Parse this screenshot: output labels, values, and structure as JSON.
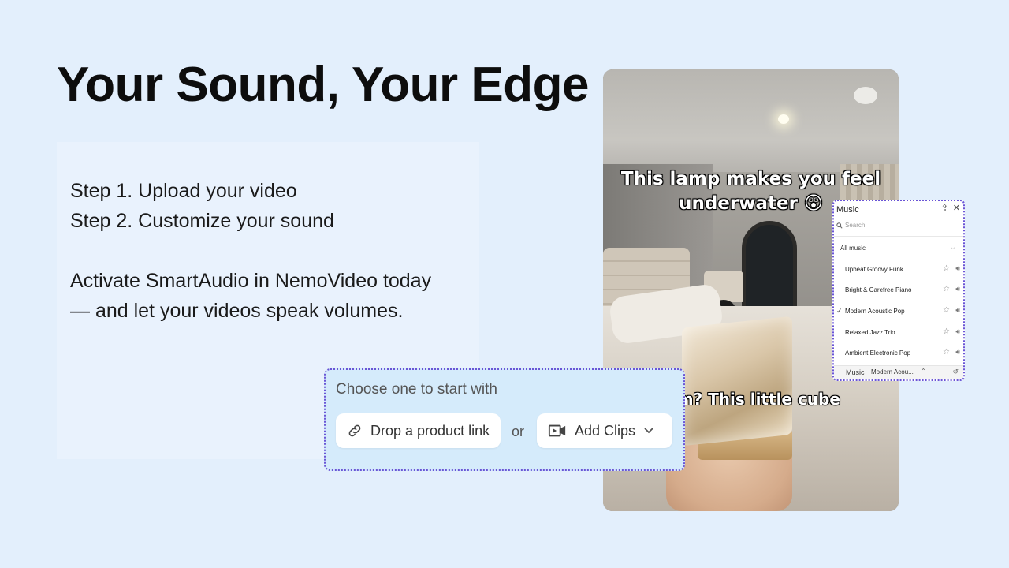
{
  "headline": "Your Sound, Your Edge",
  "steps": {
    "step1": "Step 1. Upload your video",
    "step2": "Step 2. Customize your sound",
    "cta_line1": "Activate SmartAudio in NemoVideo today",
    "cta_line2": "— and let your videos speak volumes."
  },
  "video": {
    "caption_top_line1": "This lamp makes you feel",
    "caption_top_line2": "underwater 😲",
    "caption_bottom": "om? This little cube"
  },
  "music_panel": {
    "title": "Music",
    "search_placeholder": "Search",
    "filter_label": "All music",
    "tracks": [
      {
        "name": "Upbeat Groovy Funk",
        "selected": false
      },
      {
        "name": "Bright & Carefree Piano",
        "selected": false
      },
      {
        "name": "Modern Acoustic Pop",
        "selected": true
      },
      {
        "name": "Relaxed Jazz Trio",
        "selected": false
      },
      {
        "name": "Ambient Electronic Pop",
        "selected": false
      }
    ],
    "footer_label": "Music",
    "footer_value": "Modern Acou..."
  },
  "choose_panel": {
    "title": "Choose one to start with",
    "product_link_label": "Drop a product link",
    "or_label": "or",
    "add_clips_label": "Add Clips"
  },
  "colors": {
    "background": "#e3effc",
    "dotted_border": "#6a55d6",
    "choose_panel_bg": "#d5ebfb"
  }
}
